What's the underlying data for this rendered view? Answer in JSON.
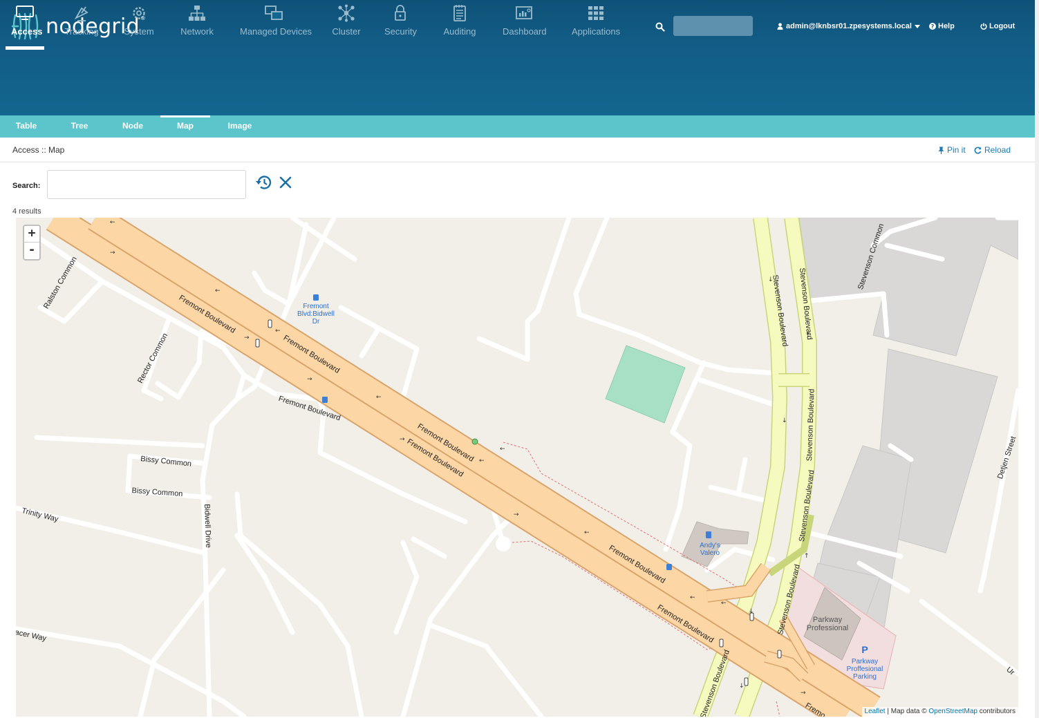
{
  "brand": {
    "name": "nodegrid",
    "reg": "®"
  },
  "header": {
    "user": "admin@lknbsr01.zpesystems.local",
    "help": "Help",
    "logout": "Logout"
  },
  "nav": {
    "items": [
      {
        "label": "Access",
        "icon": "monitor-icon"
      },
      {
        "label": "Tracking",
        "icon": "satellite-icon"
      },
      {
        "label": "System",
        "icon": "gear-icon"
      },
      {
        "label": "Network",
        "icon": "network-icon"
      },
      {
        "label": "Managed Devices",
        "icon": "devices-icon"
      },
      {
        "label": "Cluster",
        "icon": "cluster-icon"
      },
      {
        "label": "Security",
        "icon": "lock-icon"
      },
      {
        "label": "Auditing",
        "icon": "notepad-icon"
      },
      {
        "label": "Dashboard",
        "icon": "dashboard-icon"
      },
      {
        "label": "Applications",
        "icon": "grid-icon"
      }
    ],
    "active": "Access"
  },
  "subnav": {
    "tabs": [
      "Table",
      "Tree",
      "Node",
      "Map",
      "Image"
    ],
    "active": "Map"
  },
  "breadcrumb": "Access :: Map",
  "actions": {
    "pin": "Pin it",
    "reload": "Reload"
  },
  "search": {
    "label": "Search:",
    "value": "",
    "results": "4 results"
  },
  "map": {
    "zoom_in": "+",
    "zoom_out": "-",
    "attribution": {
      "leaflet": "Leaflet",
      "sep": " | Map data © ",
      "osm": "OpenStreetMap",
      "tail": " contributors"
    },
    "labels": {
      "fremont1": "Fremont Boulevard",
      "fremont2": "Fremont Boulevard",
      "fremont3": "Fremont Boulevard",
      "fremont4": "Fremont Boulevard",
      "fremont5": "Fremont Boulevard",
      "fremont6": "Fremont Boulevard",
      "fremont7": "Fremont Boulevard",
      "fremont8": "Fremont Boulevard",
      "fremont9": "Fremo",
      "stevenson1": "Stevenson Boulevard",
      "stevenson2": "Stevenson Boulevard",
      "stevenson3": "Stevenson Boulevard",
      "stevenson4": "Stevenson Boulevard",
      "stevenson5": "Stevenson Boulevard",
      "stevenson6": "Stevenson Boulevard",
      "stevenson_common": "Stevenson Common",
      "ralston": "Ralston Common",
      "rector": "Rector Common",
      "bissy1": "Bissy Common",
      "bissy2": "Bissy Common",
      "trinity": "Trinity Way",
      "bidwell": "Bidwell Drive",
      "acer": "acer Way",
      "detjen": "Detjen Street",
      "ur": "Ur",
      "busstop": "Fremont\nBlvd:Bidwell\nDr",
      "valero": "Andy's\nValero",
      "parkway_prof": "Parkway\nProfessional",
      "parkway_parking": "Parkway\nProffesional\nParking",
      "parking_p": "P"
    }
  }
}
